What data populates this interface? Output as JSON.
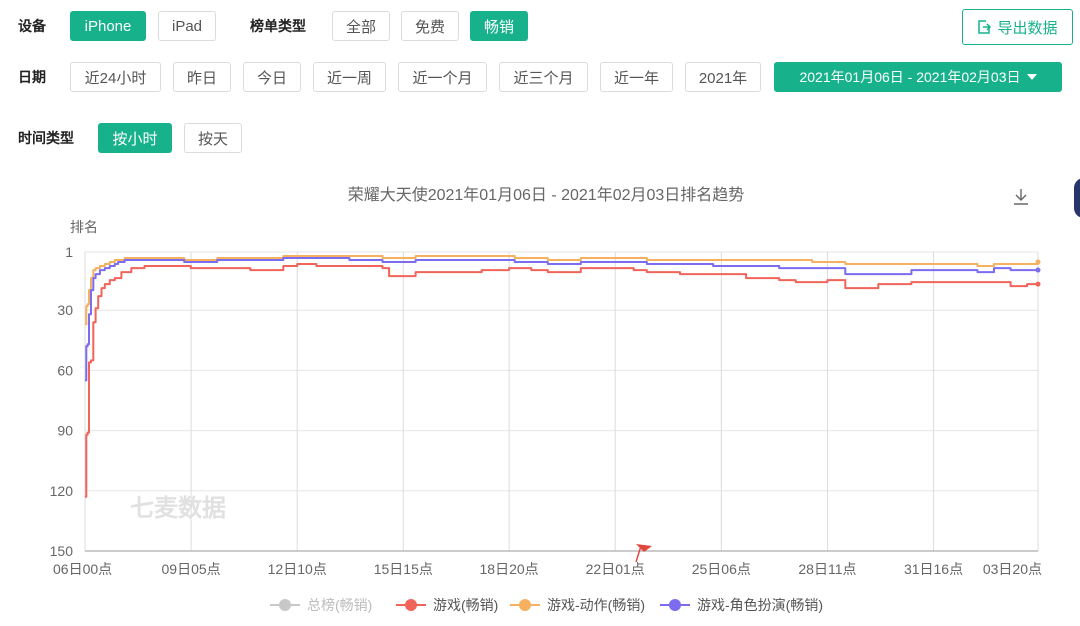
{
  "filters": {
    "device_label": "设备",
    "devices": [
      "iPhone",
      "iPad"
    ],
    "device_active": 0,
    "list_type_label": "榜单类型",
    "list_types": [
      "全部",
      "免费",
      "畅销"
    ],
    "list_type_active": 2,
    "export_label": "导出数据",
    "date_label": "日期",
    "dates": [
      "近24小时",
      "昨日",
      "今日",
      "近一周",
      "近一个月",
      "近三个月",
      "近一年",
      "2021年"
    ],
    "date_range": "2021年01月06日 - 2021年02月03日",
    "time_type_label": "时间类型",
    "time_types": [
      "按小时",
      "按天"
    ],
    "time_type_active": 0
  },
  "watermark": "七麦数据",
  "colors": {
    "accent": "#17b28c",
    "series_total": "#c8c8c8",
    "series_game": "#f0645a",
    "series_action": "#f5b060",
    "series_rpg": "#7b6cf0"
  },
  "chart_data": {
    "type": "line",
    "title": "荣耀大天使2021年01月06日 - 2021年02月03日排名趋势",
    "ylabel": "排名",
    "y_inverted": true,
    "ylim": [
      1,
      150
    ],
    "y_ticks": [
      1,
      30,
      60,
      90,
      120,
      150
    ],
    "xlim": [
      0,
      28.83
    ],
    "x_ticks": [
      0,
      3.21,
      6.42,
      9.63,
      12.83,
      16.04,
      19.25,
      22.46,
      25.67,
      28.83
    ],
    "x_tick_labels": [
      "06日00点",
      "09日05点",
      "12日10点",
      "15日15点",
      "18日20点",
      "22日01点",
      "25日06点",
      "28日11点",
      "31日16点",
      "03日20点"
    ],
    "grid": true,
    "legend_position": "bottom",
    "series": [
      {
        "name": "总榜(畅销)",
        "hidden": true,
        "x": [],
        "y": []
      },
      {
        "name": "游戏(畅销)",
        "x": [
          0,
          0.04,
          0.08,
          0.12,
          0.18,
          0.25,
          0.32,
          0.4,
          0.5,
          0.6,
          0.75,
          0.9,
          1.1,
          1.4,
          1.8,
          2.5,
          2.8,
          3.2,
          3.21,
          4.0,
          5.0,
          6.0,
          6.42,
          7.0,
          8.0,
          9.0,
          9.2,
          9.63,
          10.0,
          11.0,
          12.0,
          12.83,
          13.5,
          14.0,
          15.0,
          16.04,
          16.6,
          17.0,
          18.0,
          19.0,
          19.25,
          20.0,
          21.0,
          21.5,
          22.46,
          23.0,
          24.0,
          25.0,
          25.67,
          26.0,
          27.0,
          28.0,
          28.5,
          28.83
        ],
        "y": [
          123,
          92,
          91,
          56,
          55,
          36,
          29,
          23,
          19,
          17,
          15,
          14,
          11,
          9,
          8,
          8,
          8,
          9,
          9,
          9,
          10,
          8,
          7,
          8,
          8,
          9,
          13,
          13,
          11,
          11,
          10,
          9,
          10,
          11,
          9,
          9,
          10,
          11,
          12,
          12,
          12,
          14,
          15,
          16,
          15,
          19,
          17,
          16,
          16,
          16,
          16,
          18,
          17,
          17
        ]
      },
      {
        "name": "游戏-动作(畅销)",
        "x": [
          0,
          0.04,
          0.08,
          0.12,
          0.18,
          0.25,
          0.32,
          0.45,
          0.6,
          0.75,
          0.9,
          1.0,
          1.2,
          1.5,
          2.0,
          3.0,
          3.21,
          4.0,
          5.0,
          6.0,
          6.42,
          7.0,
          8.0,
          9.0,
          9.63,
          10.0,
          11.0,
          12.0,
          12.83,
          13.0,
          14.0,
          15.0,
          16.04,
          17.0,
          18.0,
          19.0,
          19.25,
          20.0,
          21.0,
          22.0,
          22.46,
          23.0,
          24.0,
          25.0,
          25.67,
          26.0,
          27.0,
          27.5,
          28.0,
          28.83
        ],
        "y": [
          37,
          28,
          27,
          20,
          14,
          10,
          9,
          8,
          7,
          6,
          5,
          5,
          4,
          4,
          4,
          5,
          5,
          4,
          4,
          3,
          3,
          3,
          3,
          4,
          4,
          3,
          3,
          3,
          3,
          4,
          5,
          4,
          4,
          5,
          5,
          5,
          5,
          5,
          5,
          6,
          6,
          7,
          7,
          7,
          7,
          7,
          8,
          7,
          7,
          6
        ]
      },
      {
        "name": "游戏-角色扮演(畅销)",
        "x": [
          0,
          0.04,
          0.08,
          0.12,
          0.18,
          0.25,
          0.32,
          0.45,
          0.6,
          0.75,
          0.9,
          1.0,
          1.2,
          1.5,
          2.0,
          3.0,
          3.21,
          4.0,
          5.0,
          6.0,
          6.42,
          7.0,
          8.0,
          9.0,
          9.63,
          10.0,
          11.0,
          12.0,
          12.83,
          13.0,
          14.0,
          15.0,
          16.04,
          17.0,
          18.0,
          19.0,
          19.25,
          20.0,
          21.0,
          22.0,
          22.46,
          23.0,
          24.0,
          25.0,
          25.67,
          26.0,
          27.0,
          27.5,
          28.0,
          28.83
        ],
        "y": [
          65,
          48,
          47,
          32,
          20,
          14,
          12,
          10,
          9,
          8,
          7,
          6,
          5,
          5,
          5,
          6,
          6,
          5,
          5,
          4,
          4,
          4,
          5,
          6,
          6,
          5,
          5,
          5,
          5,
          6,
          7,
          6,
          6,
          7,
          7,
          8,
          8,
          8,
          9,
          9,
          9,
          12,
          12,
          10,
          10,
          10,
          11,
          9,
          10,
          10
        ]
      }
    ]
  }
}
